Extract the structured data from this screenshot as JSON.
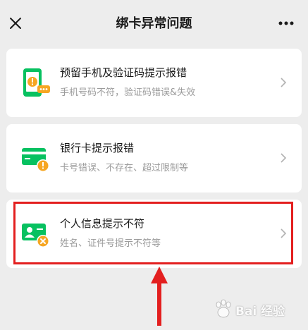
{
  "header": {
    "title": "绑卡异常问题",
    "close_icon": "close-icon",
    "more_icon": "more-icon"
  },
  "cards": [
    {
      "title": "预留手机及验证码提示报错",
      "subtitle": "手机号码不符，验证码错误&失效",
      "icon": "phone-warning-icon"
    },
    {
      "title": "银行卡提示报错",
      "subtitle": "卡号错误、不存在、超过限制等",
      "icon": "bank-card-warning-icon"
    },
    {
      "title": "个人信息提示不符",
      "subtitle": "姓名、证件号提示不符等",
      "icon": "id-card-error-icon"
    }
  ],
  "watermark": {
    "text": "Bai 经验",
    "icon": "baidu-paw-icon"
  },
  "colors": {
    "accent_green": "#07c160",
    "warning_orange": "#f6a623",
    "highlight_red": "#e31f1f"
  }
}
